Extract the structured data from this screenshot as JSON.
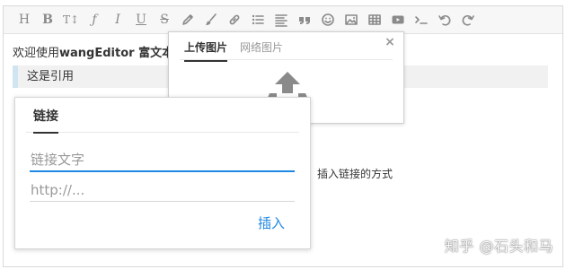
{
  "toolbar": {
    "items": [
      {
        "name": "head",
        "glyph": "H"
      },
      {
        "name": "bold",
        "glyph": "B"
      },
      {
        "name": "font-size",
        "glyph": "T↕"
      },
      {
        "name": "font-name",
        "glyph": "ƒ"
      },
      {
        "name": "italic",
        "glyph": "I"
      },
      {
        "name": "underline",
        "glyph": "U"
      },
      {
        "name": "strike-through",
        "glyph": "S"
      }
    ]
  },
  "content": {
    "para1_prefix": "欢迎使用",
    "para1_bold": "wangEditor 富文本编",
    "quote": "这是引用",
    "para3": "插入链接的方式"
  },
  "image_panel": {
    "tab_upload": "上传图片",
    "tab_network": "网络图片",
    "close": "×"
  },
  "link_panel": {
    "tab": "链接",
    "text_placeholder": "链接文字",
    "url_placeholder": "http://...",
    "insert_label": "插入"
  },
  "watermark": "知乎 @石头和马",
  "colors": {
    "accent": "#1e88e5",
    "icon": "#8a8a8a",
    "toolbar_bg": "#f7f7f7",
    "quote_bg": "#f1f1f1",
    "quote_border": "#d0e5f2"
  }
}
